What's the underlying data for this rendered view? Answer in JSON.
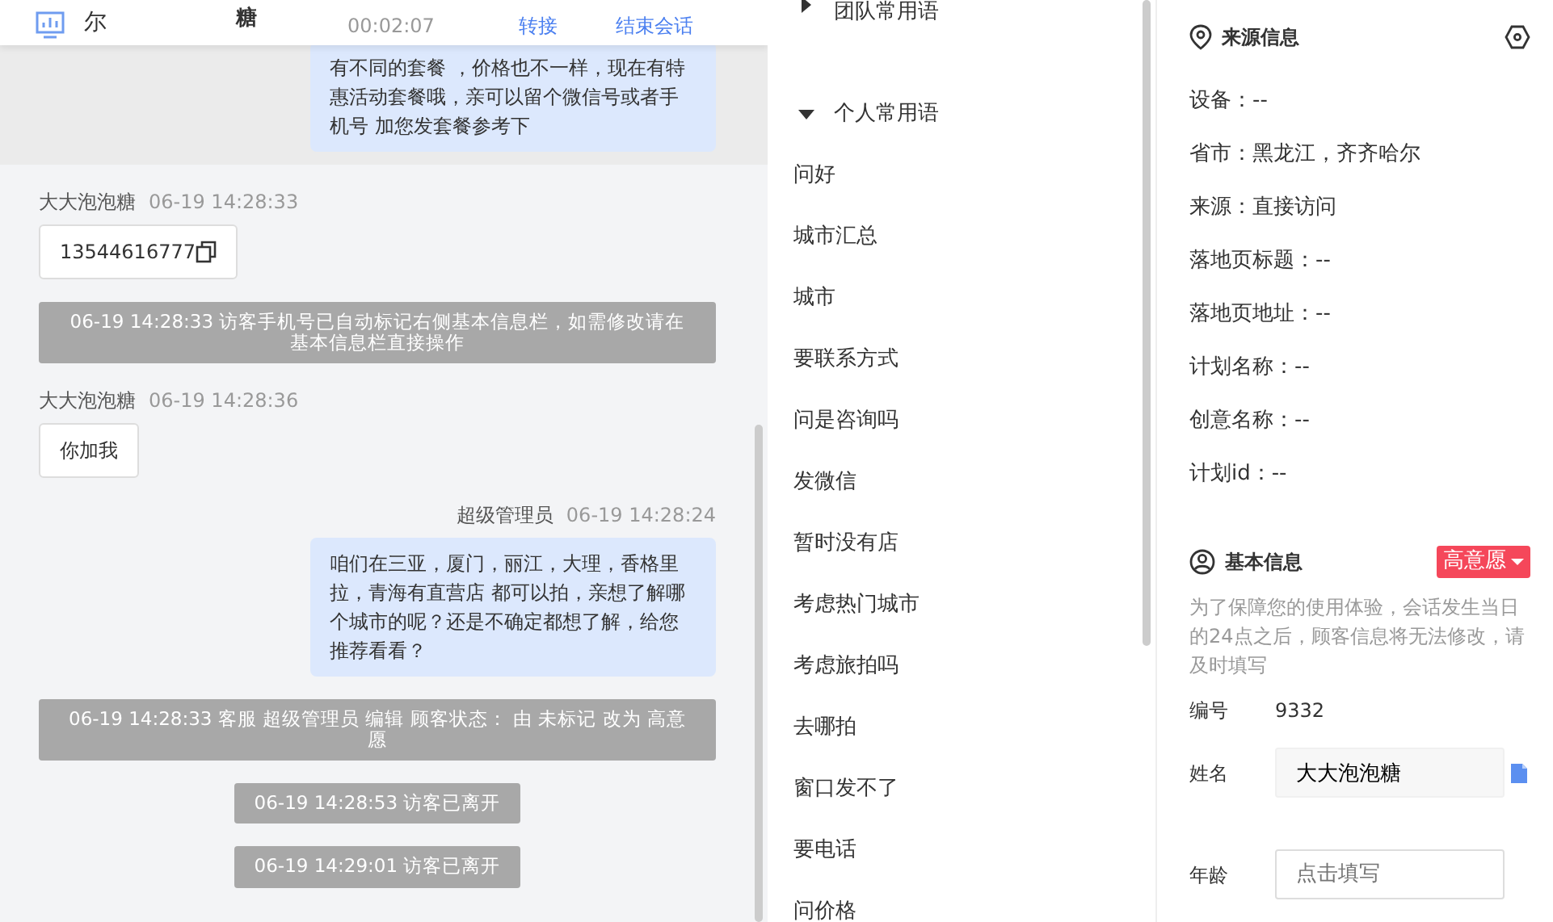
{
  "chat_header": {
    "visitor_region": "尔",
    "visitor_name": "糖",
    "duration": "00:02:07",
    "actions": [
      "转接",
      "结束会话"
    ]
  },
  "messages": [
    {
      "kind": "agent",
      "highlighted": true,
      "text": "有不同的套餐 ，价格也不一样，现在有特惠活动套餐哦，亲可以留个微信号或者手机号 加您发套餐参考下"
    },
    {
      "kind": "visitor",
      "sender": "大大泡泡糖",
      "time": "06-19 14:28:33",
      "text": "13544616777",
      "copyable": true
    },
    {
      "kind": "system",
      "text": "06-19 14:28:33 访客手机号已自动标记右侧基本信息栏，如需修改请在基本信息栏直接操作"
    },
    {
      "kind": "visitor",
      "sender": "大大泡泡糖",
      "time": "06-19 14:28:36",
      "text": "你加我",
      "copyable": false
    },
    {
      "kind": "agent",
      "sender": "超级管理员",
      "time": "06-19 14:28:24",
      "highlighted": false,
      "text": "咱们在三亚，厦门，丽江，大理，香格里拉，青海有直营店 都可以拍，亲想了解哪个城市的呢？还是不确定都想了解，给您推荐看看？"
    },
    {
      "kind": "system",
      "text": "06-19 14:28:33 客服 超级管理员 编辑 顾客状态： 由 未标记 改为 高意愿"
    },
    {
      "kind": "notice",
      "text": "06-19 14:28:53 访客已离开"
    },
    {
      "kind": "notice",
      "text": "06-19 14:29:01 访客已离开"
    }
  ],
  "phrases": {
    "groups": [
      {
        "title": "团队常用语",
        "expanded": false
      },
      {
        "title": "个人常用语",
        "expanded": true,
        "items": [
          "问好",
          "城市汇总",
          "城市",
          "要联系方式",
          "问是咨询吗",
          "发微信",
          "暂时没有店",
          "考虑热门城市",
          "考虑旅拍吗",
          "去哪拍",
          "窗口发不了",
          "要电话",
          "问价格"
        ]
      }
    ]
  },
  "source_info": {
    "title": "来源信息",
    "rows": [
      "设备：--",
      "省市：黑龙江，齐齐哈尔",
      "来源：直接访问",
      "落地页标题：--",
      "落地页地址：--",
      "计划名称：--",
      "创意名称：--",
      "计划id：--"
    ]
  },
  "basic_info": {
    "title": "基本信息",
    "intent_tag": "高意愿",
    "notice": "为了保障您的使用体验，会话发生当日的24点之后，顾客信息将无法修改，请及时填写",
    "fields": [
      {
        "kind": "text",
        "label": "编号",
        "value": "9332"
      },
      {
        "kind": "input",
        "label": "姓名",
        "value": "大大泡泡糖",
        "copyable": true
      },
      {
        "kind": "input",
        "label": "年龄",
        "placeholder": "点击填写",
        "copyable": false
      }
    ]
  }
}
